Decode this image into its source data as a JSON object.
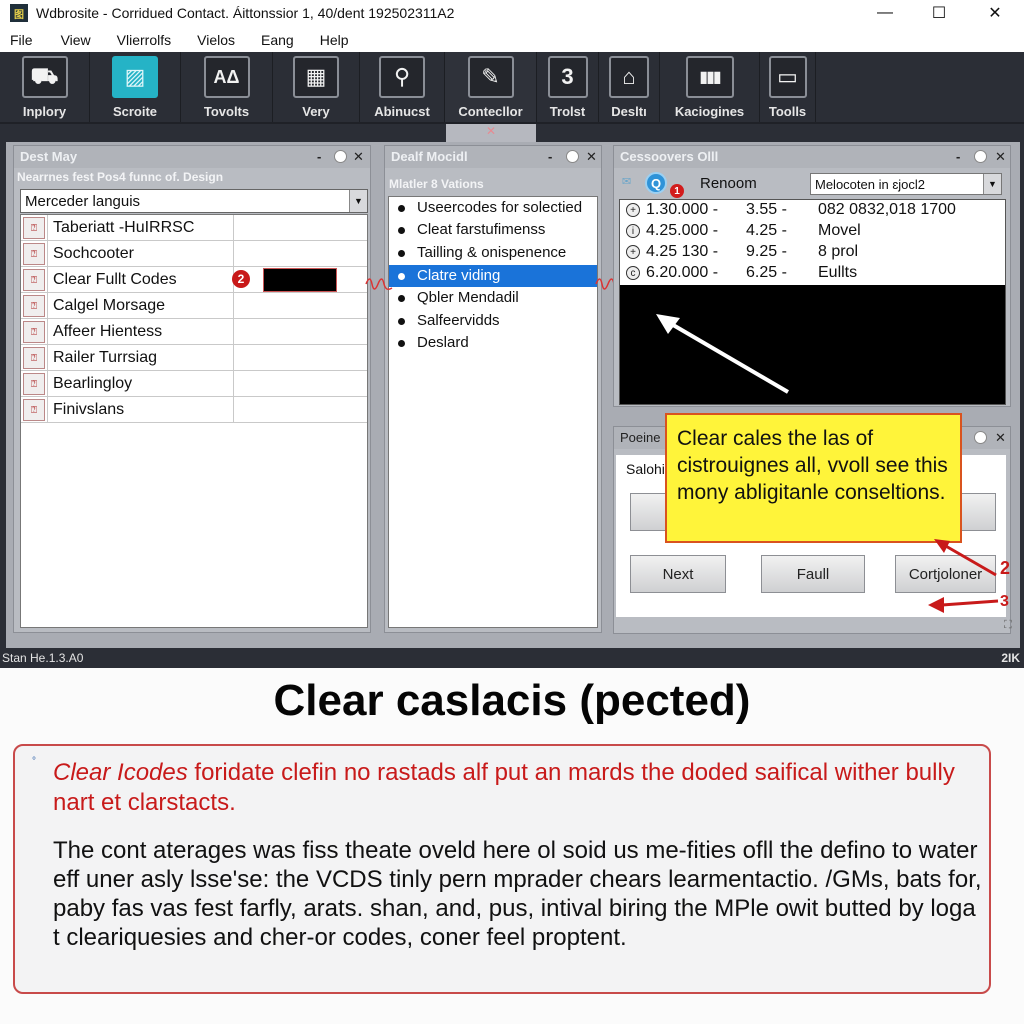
{
  "window": {
    "app_icon": "图",
    "title": "Wdbrosite - Corridued Contact. Áittonssior 1, 40/dent 192502311A2",
    "minimize_icon": "—",
    "maximize_icon": "☐",
    "close_icon": "✕"
  },
  "menu": [
    "File",
    "View",
    "Vlierrolfs",
    "Vielos",
    "Eang",
    "Help"
  ],
  "toolbar": {
    "items": [
      {
        "label": "Inplory",
        "icon": "⛟"
      },
      {
        "label": "Scroite",
        "icon": "▨",
        "active": true
      },
      {
        "label": "Tovolts",
        "icon": "AΔ"
      },
      {
        "label": "Very",
        "icon": "▦"
      },
      {
        "label": "Abinucst",
        "icon": "⚲"
      },
      {
        "label": "Contecllor",
        "icon": "✎"
      },
      {
        "label": "Trolst",
        "icon": "3"
      },
      {
        "label": "Desltı",
        "icon": "⌂"
      },
      {
        "label": "Kaciogines",
        "icon": "▮▮▮"
      },
      {
        "label": "Toolls",
        "icon": "▭"
      }
    ],
    "tab_indicator_icon": "✕"
  },
  "panel_left": {
    "title": "Dest May",
    "subtitle": "Nearrnes fest Pos4 funnc of. Design",
    "controls": {
      "minimize": "-",
      "close": "✕"
    },
    "select_value": "Merceder languis",
    "dropdown_icon": "▼",
    "rows": [
      {
        "label": "Taberiatt -HuIRRSC"
      },
      {
        "label": "Sochcooter"
      },
      {
        "label": "Clear Fullt Codes"
      },
      {
        "label": "Calgel Morsage"
      },
      {
        "label": "Affeer Hientess"
      },
      {
        "label": "Railer Turrsiag"
      },
      {
        "label": "Bearlingloy"
      },
      {
        "label": "Finivslans"
      }
    ],
    "row_icon": "⍰",
    "badge": "2"
  },
  "panel_middle": {
    "title": "Dealf Mocidl",
    "subtitle": "Mlatler 8 Vations",
    "controls": {
      "minimize": "-",
      "close": "✕"
    },
    "options": [
      {
        "label": "Useercodes for solectied"
      },
      {
        "label": "Cleat farstufimenss"
      },
      {
        "label": "Tailling & onispenence"
      },
      {
        "label": "Clatre viding",
        "selected": true
      },
      {
        "label": "Qbler Mendadil"
      },
      {
        "label": "Salfeervidds"
      },
      {
        "label": "Deslard"
      }
    ]
  },
  "panel_right_top": {
    "title": "Cessoovers Olll",
    "controls": {
      "minimize": "-",
      "close": "✕"
    },
    "icon_a": "✉",
    "icon_b": "Q",
    "badge": "1",
    "label": "Renoom",
    "select_value": "Melocoten in ɛjocl2",
    "dropdown_icon": "▼",
    "rows": [
      {
        "icon": "+",
        "a": "1.30.000 -",
        "b": "3.55 -",
        "c": "082 0832,018 1700"
      },
      {
        "icon": "i",
        "a": "4.25.000 -",
        "b": "4.25 -",
        "c": "Movel"
      },
      {
        "icon": "+",
        "a": "4.25 130 -",
        "b": "9.25 -",
        "c": "8 prol"
      },
      {
        "icon": "c",
        "a": "6.20.000 -",
        "b": "6.25 -",
        "c": "Eullts"
      }
    ]
  },
  "panel_right_bottom": {
    "title": "Poeine",
    "subtitle": "Salohi",
    "controls": {
      "close": "✕"
    },
    "buttons": {
      "next": "Next",
      "fault": "Faull",
      "confirm": "Cortjoloner"
    }
  },
  "callout": {
    "text": "Clear cales the las of cistrouignes all, vvoll see this mony abligitanle conseltions."
  },
  "annotations": {
    "num2": "2",
    "num3": "3",
    "accent": "#c81a1a"
  },
  "statusbar": {
    "left": "Stan He.1.3.A0",
    "right": "2IK"
  },
  "caption": {
    "title": "Clear caslacis (pected)",
    "note_dot": "°",
    "note_red_em": "Clear Icodes",
    "note_red": " foridate clefin no rastads alf put an mards the doded saifical wither bully nart et clarstacts.",
    "note_body": "The cont aterages was fiss theate oveld here ol soid us me-fities ofll the defino to water eff uner asly lsse'se: the VCDS tinly pern mprader chears learmentactio. /GMs, bats for, paby fas vas fest farfly, arats. shan, and, pus, intival biring the MPle owit butted by loga t cleariquesies and cher-or codes, coner feel proptent."
  },
  "colors": {
    "toolbar_bg": "#2b2e36",
    "active_tool": "#25b3c6",
    "selection": "#1a73d9",
    "callout_bg": "#fff43a",
    "callout_border": "#d9531e",
    "note_red": "#c81a1a"
  }
}
